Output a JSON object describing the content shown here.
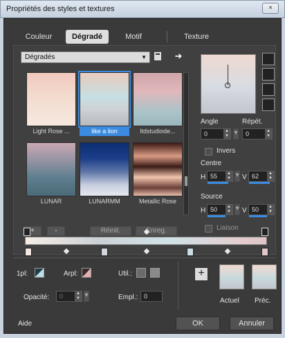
{
  "window": {
    "title": "Propriétés des styles et textures",
    "close_label": "×"
  },
  "tabs": [
    {
      "label": "Couleur"
    },
    {
      "label": "Dégradé"
    },
    {
      "label": "Motif"
    },
    {
      "label": "Texture"
    }
  ],
  "library": {
    "dropdown_value": "Dégradés",
    "swatches": [
      {
        "label": "Light Rose ..."
      },
      {
        "label": "like a lion"
      },
      {
        "label": "ltdstudiode..."
      },
      {
        "label": "LUNAR"
      },
      {
        "label": "LUNARMM"
      },
      {
        "label": "Metallic Rose"
      }
    ]
  },
  "gradient_params": {
    "angle_label": "Angle",
    "angle_value": "0",
    "repeat_label": "Répét.",
    "repeat_value": "0",
    "invert_label": "Invers",
    "centre_label": "Centre",
    "centre_h_label": "H",
    "centre_h_value": "55",
    "centre_v_label": "V",
    "centre_v_value": "62",
    "source_label": "Source",
    "source_h_label": "H",
    "source_h_value": "50",
    "source_v_label": "V",
    "source_v_value": "50",
    "link_label": "Liaison"
  },
  "stop_controls": {
    "add_label": "+",
    "remove_label": "-",
    "reset_label": "Réinit.",
    "save_label": "Enreg."
  },
  "options": {
    "first_label": "1pl:",
    "arpl_label": "Arpl:",
    "util_label": "Util.:",
    "opacity_label": "Opacité:",
    "opacity_value": "0",
    "empl_label": "Empl.:",
    "empl_value": "0"
  },
  "current_label": "Actuel",
  "previous_label": "Préc.",
  "add_current_label": "+",
  "footer": {
    "help": "Aide",
    "ok": "OK",
    "cancel": "Annuler"
  },
  "icons": [
    "swatch-book-icon",
    "arrow-right-icon",
    "close-icon"
  ]
}
